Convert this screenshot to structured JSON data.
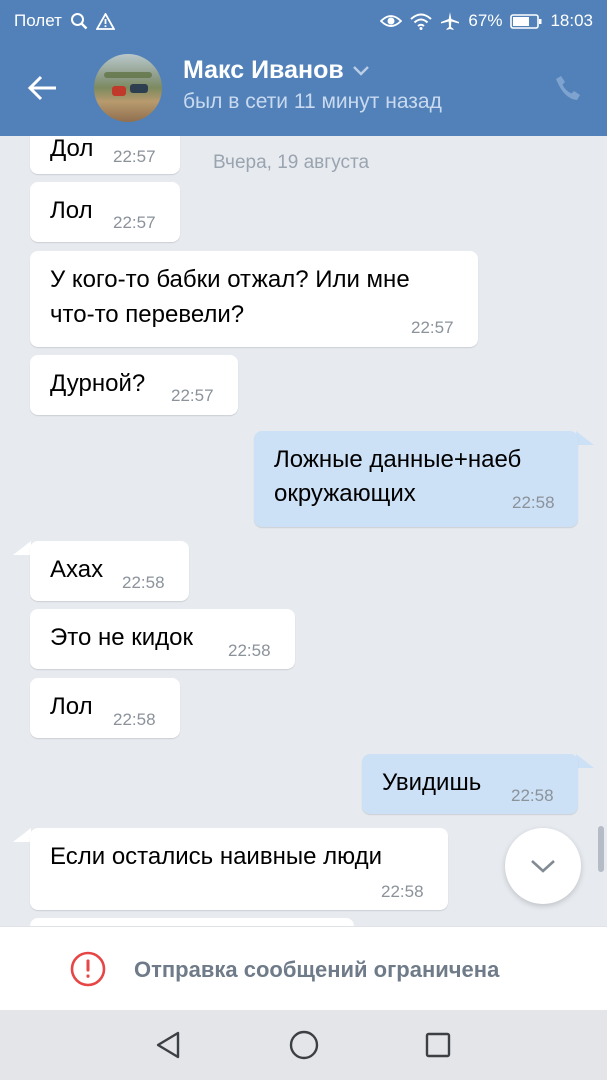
{
  "colors": {
    "header_bg": "#5181b8",
    "chat_bg": "#e7ebf0",
    "incoming_bubble": "#ffffff",
    "outgoing_bubble": "#cce0f6",
    "alert_red": "#e64646"
  },
  "status_bar": {
    "carrier": "Полет",
    "battery": "67%",
    "time": "18:03",
    "icons": [
      "search-icon",
      "warning-icon",
      "eye-icon",
      "wifi-icon",
      "airplane-icon",
      "battery-icon"
    ]
  },
  "header": {
    "name": "Макс Иванов",
    "last_seen": "был в сети 11 минут назад",
    "icons": [
      "back-arrow-icon",
      "chevron-down-icon",
      "phone-icon"
    ]
  },
  "chat": {
    "date_separator": "Вчера, 19 августа",
    "messages": [
      {
        "direction": "in",
        "lines": [
          "Дол"
        ],
        "time": "22:57"
      },
      {
        "direction": "in",
        "lines": [
          "Лол"
        ],
        "time": "22:57"
      },
      {
        "direction": "in",
        "lines": [
          "У кого-то бабки отжал? Или мне",
          "что-то перевели?"
        ],
        "time": "22:57"
      },
      {
        "direction": "in",
        "lines": [
          "Дурной?"
        ],
        "time": "22:57"
      },
      {
        "direction": "out",
        "lines": [
          "Ложные данные+наеб",
          "окружающих"
        ],
        "time": "22:58"
      },
      {
        "direction": "in",
        "lines": [
          "Ахах"
        ],
        "time": "22:58"
      },
      {
        "direction": "in",
        "lines": [
          "Это не кидок"
        ],
        "time": "22:58"
      },
      {
        "direction": "in",
        "lines": [
          "Лол"
        ],
        "time": "22:58"
      },
      {
        "direction": "out",
        "lines": [
          "Увидишь"
        ],
        "time": "22:58"
      },
      {
        "direction": "in",
        "lines": [
          "Если остались наивные люди"
        ],
        "time": "22:58"
      }
    ]
  },
  "restriction": {
    "text": "Отправка сообщений ограничена",
    "icon": "alert-circle-icon"
  },
  "nav_bar": {
    "icons": [
      "back-triangle-icon",
      "home-circle-icon",
      "recents-square-icon"
    ]
  }
}
